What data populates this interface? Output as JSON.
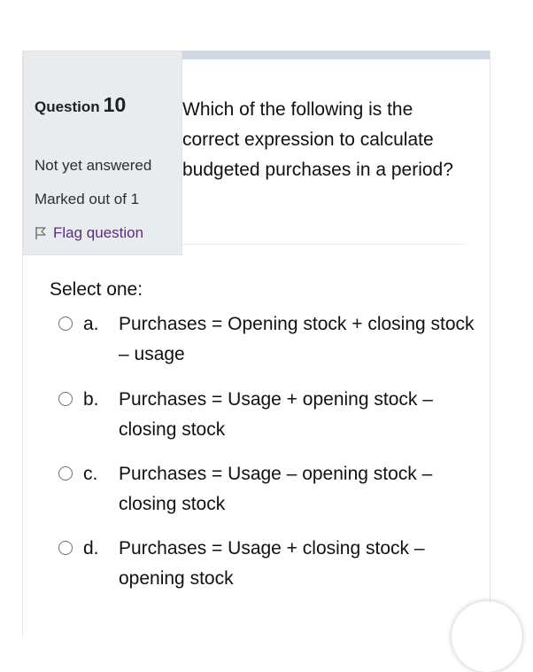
{
  "question": {
    "label": "Question",
    "number": "10",
    "state": "Not yet answered",
    "grade": "Marked out of 1",
    "flag_label": "Flag question",
    "text": "Which of the following is the correct expression to calculate budgeted purchases in a period?"
  },
  "answer": {
    "prompt": "Select one:",
    "options": [
      {
        "letter": "a.",
        "text": "Purchases  = Opening stock + closing stock – usage"
      },
      {
        "letter": "b.",
        "text": "Purchases = Usage + opening stock – closing stock"
      },
      {
        "letter": "c.",
        "text": "Purchases = Usage – opening stock – closing stock"
      },
      {
        "letter": "d.",
        "text": "Purchases = Usage + closing stock – opening stock"
      }
    ]
  },
  "colors": {
    "info_bg": "#e9ecef",
    "flag_link": "#5a2d82",
    "top_bar": "#cfd7e3"
  }
}
